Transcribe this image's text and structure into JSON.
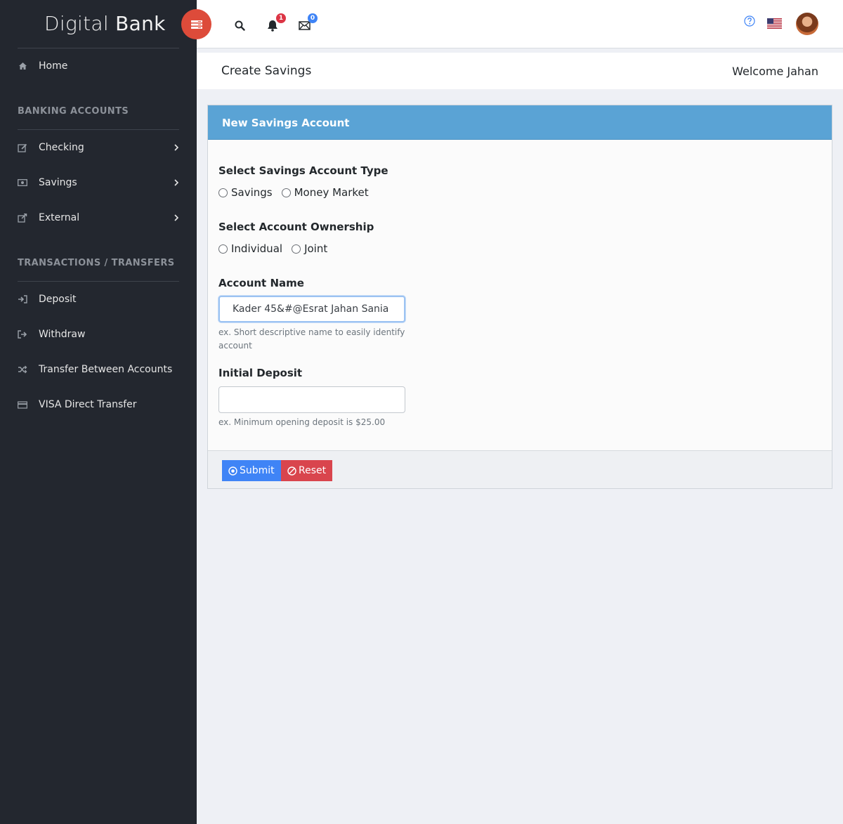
{
  "brand": {
    "light": "Digital",
    "bold": "Bank"
  },
  "sidebar": {
    "home": "Home",
    "section_accounts": "BANKING ACCOUNTS",
    "accounts": [
      {
        "label": "Checking"
      },
      {
        "label": "Savings"
      },
      {
        "label": "External"
      }
    ],
    "section_transactions": "TRANSACTIONS / TRANSFERS",
    "transactions": [
      {
        "label": "Deposit"
      },
      {
        "label": "Withdraw"
      },
      {
        "label": "Transfer Between Accounts"
      },
      {
        "label": "VISA Direct Transfer"
      }
    ]
  },
  "topbar": {
    "notification_count": "1",
    "message_count": "0"
  },
  "page": {
    "title": "Create Savings",
    "welcome": "Welcome Jahan"
  },
  "form": {
    "header": "New Savings Account",
    "type_label": "Select Savings Account Type",
    "type_options": [
      "Savings",
      "Money Market"
    ],
    "ownership_label": "Select Account Ownership",
    "ownership_options": [
      "Individual",
      "Joint"
    ],
    "name_label": "Account Name",
    "name_value": "Kader 45&#@Esrat Jahan Sania",
    "name_help": "ex. Short descriptive name to easily identify account",
    "deposit_label": "Initial Deposit",
    "deposit_value": "",
    "deposit_help": "ex. Minimum opening deposit is $25.00",
    "submit_label": "Submit",
    "reset_label": "Reset"
  },
  "colors": {
    "sidebar_bg": "#23272f",
    "toggle_red": "#dd4b3a",
    "card_header_blue": "#5aa3d5",
    "submit_blue": "#3f84f6",
    "reset_red": "#d9454d",
    "badge_red": "#dc3545",
    "badge_blue": "#3f84f6"
  },
  "icons": {
    "toggle": "menu-toggle-icon",
    "search": "search-icon",
    "bell": "bell-icon",
    "mail": "envelope-icon",
    "help": "question-circle-icon",
    "flag": "us-flag-icon"
  }
}
